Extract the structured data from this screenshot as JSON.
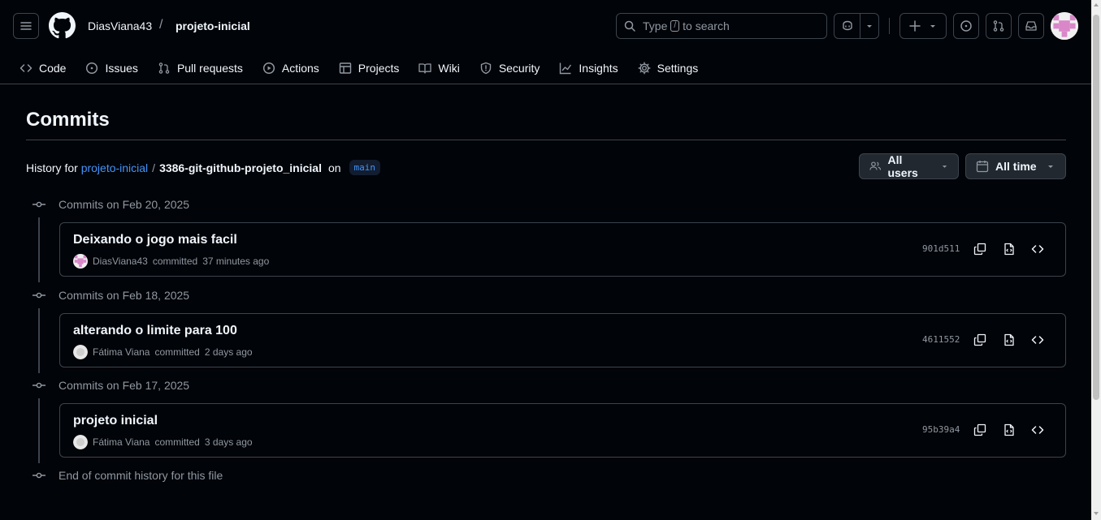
{
  "header": {
    "owner": "DiasViana43",
    "separator": "/",
    "repo": "projeto-inicial",
    "search": {
      "prefix": "Type",
      "key": "/",
      "suffix": "to search"
    }
  },
  "nav": {
    "tabs": [
      {
        "label": "Code",
        "icon": "code-icon"
      },
      {
        "label": "Issues",
        "icon": "issue-icon"
      },
      {
        "label": "Pull requests",
        "icon": "pull-request-icon"
      },
      {
        "label": "Actions",
        "icon": "play-icon"
      },
      {
        "label": "Projects",
        "icon": "table-icon"
      },
      {
        "label": "Wiki",
        "icon": "book-icon"
      },
      {
        "label": "Security",
        "icon": "shield-icon"
      },
      {
        "label": "Insights",
        "icon": "graph-icon"
      },
      {
        "label": "Settings",
        "icon": "gear-icon"
      }
    ]
  },
  "page": {
    "title": "Commits",
    "history_prefix": "History for",
    "history_repo": "projeto-inicial",
    "history_sep": "/",
    "history_path": "3386-git-github-projeto_inicial",
    "history_on": "on",
    "branch": "main",
    "filter_users": "All users",
    "filter_time": "All time"
  },
  "commit_groups": [
    {
      "label": "Commits on Feb 20, 2025",
      "commit": {
        "message": "Deixando o jogo mais facil",
        "author": "DiasViana43",
        "action": "committed",
        "time": "37 minutes ago",
        "sha": "901d511"
      }
    },
    {
      "label": "Commits on Feb 18, 2025",
      "commit": {
        "message": "alterando o limite para 100",
        "author": "Fátima Viana",
        "action": "committed",
        "time": "2 days ago",
        "sha": "4611552"
      }
    },
    {
      "label": "Commits on Feb 17, 2025",
      "commit": {
        "message": "projeto inicial",
        "author": "Fátima Viana",
        "action": "committed",
        "time": "3 days ago",
        "sha": "95b39a4"
      }
    }
  ],
  "end_text": "End of commit history for this file",
  "colors": {
    "background": "#010409",
    "border": "#3d444d",
    "link": "#4493f8",
    "muted": "#9198a1"
  }
}
